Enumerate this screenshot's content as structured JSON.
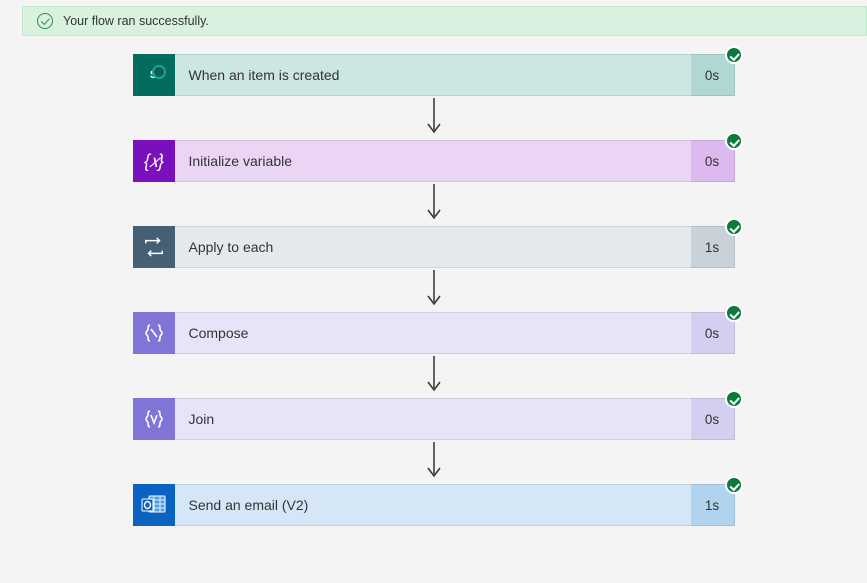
{
  "banner": {
    "message": "Your flow ran successfully."
  },
  "steps": [
    {
      "key": "trigger",
      "label": "When an item is created",
      "duration": "0s",
      "status": "success",
      "type": "sharepoint"
    },
    {
      "key": "init_var",
      "label": "Initialize variable",
      "duration": "0s",
      "status": "success",
      "type": "variable"
    },
    {
      "key": "apply",
      "label": "Apply to each",
      "duration": "1s",
      "status": "success",
      "type": "control-loop"
    },
    {
      "key": "compose",
      "label": "Compose",
      "duration": "0s",
      "status": "success",
      "type": "data-operation"
    },
    {
      "key": "join",
      "label": "Join",
      "duration": "0s",
      "status": "success",
      "type": "data-operation"
    },
    {
      "key": "email",
      "label": "Send an email (V2)",
      "duration": "1s",
      "status": "success",
      "type": "outlook"
    }
  ]
}
